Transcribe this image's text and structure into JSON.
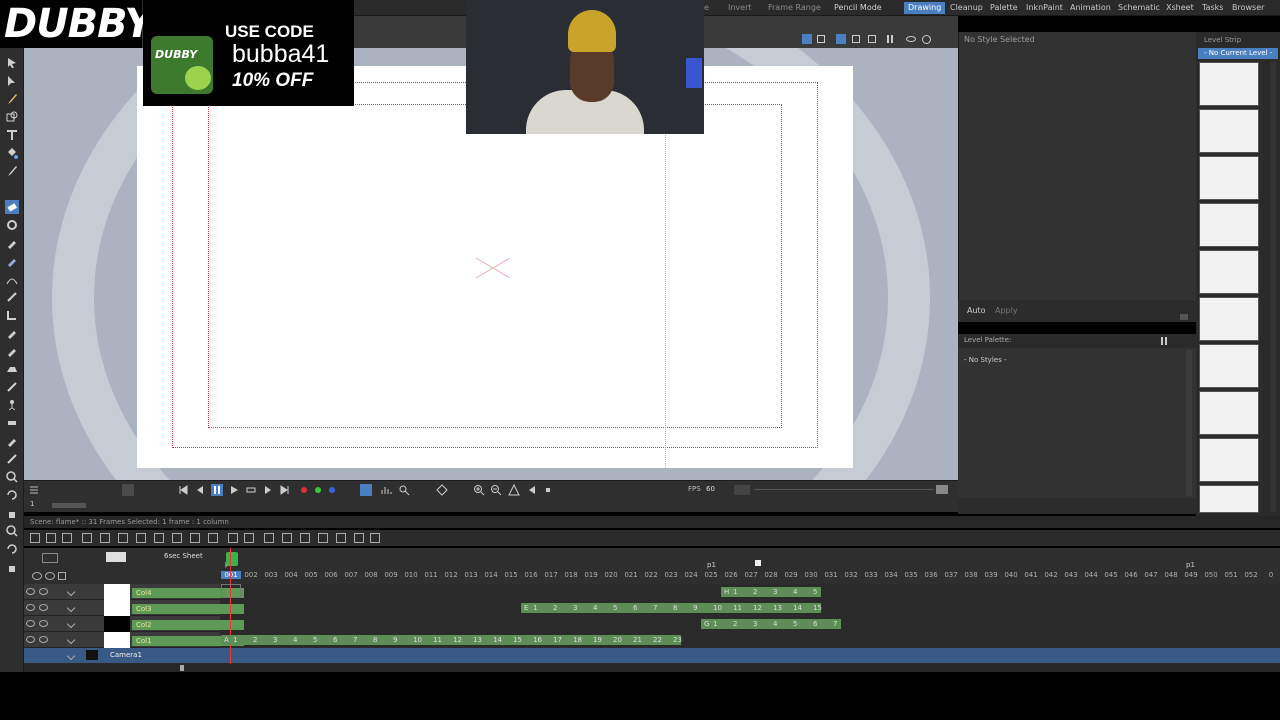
{
  "rooms": [
    "Drawing",
    "Cleanup",
    "Palette",
    "InknPaint",
    "Animation",
    "Schematic",
    "Xsheet",
    "Tasks",
    "Browser"
  ],
  "active_room": "Drawing",
  "viewer_menu": {
    "item1": "e",
    "invert": "Invert",
    "frame_range": "Frame Range",
    "pencil_mode": "Pencil Mode"
  },
  "style_editor": {
    "title": "No Style Selected",
    "auto_label": "Auto",
    "apply_label": "Apply"
  },
  "level_palette": {
    "title": "Level Palette:",
    "empty": "- No Styles -"
  },
  "level_strip": {
    "title": "Level Strip",
    "current": "- No Current Level -"
  },
  "viewer_bar": {
    "fps_label": "FPS",
    "fps_value": "60",
    "frame_field": "1"
  },
  "xsheet": {
    "status": "Scene: flame*  ::  31 Frames  Selected: 1 frame : 1 column",
    "sheet_mode": "6sec Sheet",
    "frame_numbers": [
      "001",
      "002",
      "003",
      "004",
      "005",
      "006",
      "007",
      "008",
      "009",
      "010",
      "011",
      "012",
      "013",
      "014",
      "015",
      "016",
      "017",
      "018",
      "019",
      "020",
      "021",
      "022",
      "023",
      "024",
      "025",
      "026",
      "027",
      "028",
      "029",
      "030",
      "031",
      "032",
      "033",
      "034",
      "035",
      "036",
      "037",
      "038",
      "039",
      "040",
      "041",
      "042",
      "043",
      "044",
      "045",
      "046",
      "047",
      "048",
      "049",
      "050",
      "051",
      "052",
      "0"
    ],
    "playhead_label": "p1",
    "marker_labels": [
      "p1",
      "p1"
    ],
    "columns": [
      {
        "name": "Col4",
        "cells_prefix": "H",
        "cells": [
          "1",
          "2",
          "3",
          "4",
          "5"
        ]
      },
      {
        "name": "Col3",
        "cells_prefix": "E",
        "cells": [
          "1",
          "2",
          "3",
          "4",
          "5",
          "6",
          "7",
          "8",
          "9",
          "10",
          "11",
          "12",
          "13",
          "14",
          "15"
        ]
      },
      {
        "name": "Col2",
        "cells_prefix": "G",
        "cells": [
          "1",
          "2",
          "3",
          "4",
          "5",
          "6",
          "7"
        ]
      },
      {
        "name": "Col1",
        "cells_prefix": "A",
        "cells": [
          "1",
          "2",
          "3",
          "4",
          "5",
          "6",
          "7",
          "8",
          "9",
          "10",
          "11",
          "12",
          "13",
          "14",
          "15",
          "16",
          "17",
          "18",
          "19",
          "20",
          "21",
          "22",
          "23"
        ]
      }
    ],
    "camera": "Camera1"
  },
  "overlay": {
    "logo": "DUBBY",
    "promo_line1": "USE CODE",
    "promo_line2": "bubba41",
    "promo_line3": "10% OFF",
    "can_label": "DUBBY"
  },
  "colors": {
    "accent": "#4a7fc1",
    "cell_green": "#5c8e56",
    "guide_red": "#dd3333",
    "camera_blue": "#3a5a86"
  }
}
